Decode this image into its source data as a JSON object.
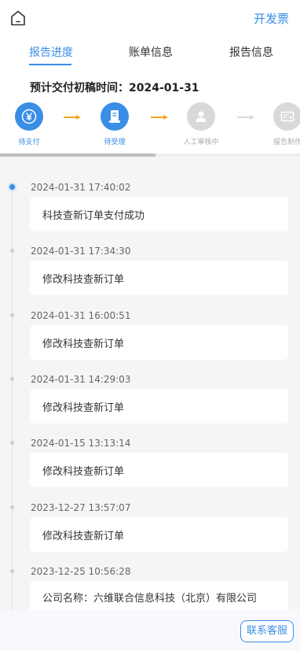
{
  "header": {
    "invoice_label": "开发票"
  },
  "tabs": [
    {
      "label": "报告进度",
      "active": true
    },
    {
      "label": "账单信息",
      "active": false
    },
    {
      "label": "报告信息",
      "active": false
    }
  ],
  "deadline": "预计交付初稿时间：2024-01-31",
  "steps": [
    {
      "label": "待支付",
      "icon": "yen-icon",
      "state": "done"
    },
    {
      "label": "待受理",
      "icon": "document-icon",
      "state": "done"
    },
    {
      "label": "人工审核中",
      "icon": "user-icon",
      "state": "todo"
    },
    {
      "label": "报告制作",
      "icon": "certificate-icon",
      "state": "todo"
    }
  ],
  "timeline": [
    {
      "time": "2024-01-31 17:40:02",
      "text": "科技查新订单支付成功",
      "current": true
    },
    {
      "time": "2024-01-31 17:34:30",
      "text": "修改科技查新订单"
    },
    {
      "time": "2024-01-31 16:00:51",
      "text": "修改科技查新订单"
    },
    {
      "time": "2024-01-31 14:29:03",
      "text": "修改科技查新订单"
    },
    {
      "time": "2024-01-15 13:13:14",
      "text": "修改科技查新订单"
    },
    {
      "time": "2023-12-27 13:57:07",
      "text": "修改科技查新订单"
    },
    {
      "time": "2023-12-25 10:56:28",
      "text": "公司名称：六维联合信息科技（北京）有限公司"
    }
  ],
  "footer": {
    "service_label": "联系客服"
  },
  "colors": {
    "accent": "#3a8ee6",
    "arrow": "#f5a623",
    "inactive": "#d9d9d9"
  }
}
